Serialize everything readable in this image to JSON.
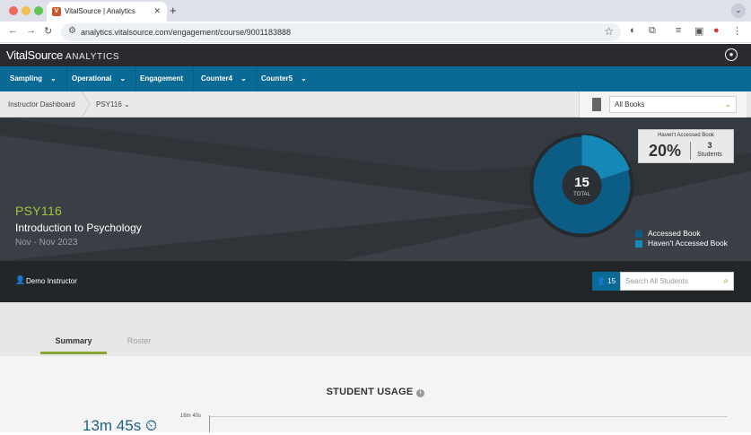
{
  "browser": {
    "tab_title": "VitalSource | Analytics",
    "tab_favicon": "V",
    "url": "analytics.vitalsource.com/engagement/course/9001183888"
  },
  "app": {
    "logo_brand": "VitalSource",
    "logo_suffix": "ANALYTICS"
  },
  "menu": [
    {
      "label": "Sampling",
      "has_dropdown": true
    },
    {
      "label": "Operational",
      "has_dropdown": true
    },
    {
      "label": "Engagement",
      "has_dropdown": false
    },
    {
      "label": "Counter4",
      "has_dropdown": true
    },
    {
      "label": "Counter5",
      "has_dropdown": true
    }
  ],
  "breadcrumb": {
    "root": "Instructor Dashboard",
    "course": "PSY116"
  },
  "book_filter": {
    "selected": "All Books"
  },
  "course": {
    "code": "PSY116",
    "title": "Introduction to Psychology",
    "dates": "Nov - Nov 2023"
  },
  "donut": {
    "total": "15",
    "total_label": "TOTAL",
    "accessed": 12,
    "not_accessed": 3,
    "colors": {
      "accessed": "#0b5d86",
      "not_accessed": "#1688b8"
    }
  },
  "tooltip": {
    "title": "Haven't Accessed Book",
    "percent": "20%",
    "count": "3",
    "unit": "Students"
  },
  "legend": [
    {
      "label": "Accessed Book",
      "color": "#0b5d86"
    },
    {
      "label": "Haven't Accessed Book",
      "color": "#1688b8"
    }
  ],
  "instructor": {
    "name": "Demo Instructor",
    "student_count": "15",
    "search_placeholder": "Search All Students"
  },
  "tabs": {
    "summary": "Summary",
    "roster": "Roster"
  },
  "usage": {
    "title": "STUDENT USAGE",
    "big_value": "13m 45s",
    "axis_tick": "16m 40s"
  },
  "colors": {
    "brand_blue": "#0a6a96",
    "accent_green": "#8aa536",
    "hero_bg": "#2f3439"
  }
}
